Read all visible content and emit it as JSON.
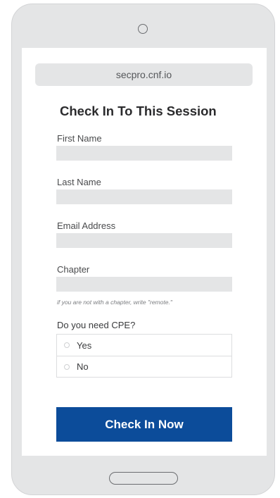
{
  "browser": {
    "url": "secpro.cnf.io"
  },
  "form": {
    "title": "Check In To This Session",
    "fields": [
      {
        "label": "First Name",
        "value": ""
      },
      {
        "label": "Last Name",
        "value": ""
      },
      {
        "label": "Email Address",
        "value": ""
      },
      {
        "label": "Chapter",
        "value": ""
      }
    ],
    "chapter_hint": "if you are not with a chapter, write \"remote.\"",
    "cpe": {
      "question": "Do you need CPE?",
      "options": [
        "Yes",
        "No"
      ]
    },
    "submit_label": "Check In Now"
  },
  "colors": {
    "device_frame": "#e4e5e6",
    "input_background": "#e4e5e6",
    "submit_button": "#0c4c9a"
  }
}
